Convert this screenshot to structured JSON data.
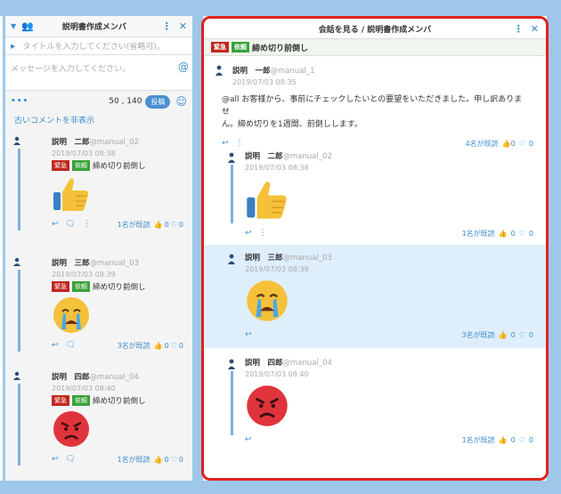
{
  "left_panel": {
    "title": "説明書作成メンバ",
    "title_placeholder": "タイトルを入力してください(省略可)。",
    "message_placeholder": "メッセージを入力してください。",
    "char_count": "50 , 140",
    "post_button": "投稿",
    "hide_old_comments": "古いコメントを非表示",
    "comments": [
      {
        "name": "説明　二郎",
        "uid": "@manual_02",
        "date": "2019/07/03 08:38",
        "tag_urgent": "緊急",
        "tag_request": "依頼",
        "subject": "締め切り前倒し",
        "emoji": "thumbs-up",
        "read_status": "1名が既読",
        "likes": "0",
        "hearts": "0"
      },
      {
        "name": "説明　三郎",
        "uid": "@manual_03",
        "date": "2019/07/03 08:39",
        "tag_urgent": "緊急",
        "tag_request": "依頼",
        "subject": "締め切り前倒し",
        "emoji": "crying-face",
        "read_status": "3名が既読",
        "likes": "0",
        "hearts": "0"
      },
      {
        "name": "説明　四郎",
        "uid": "@manual_04",
        "date": "2019/07/03 08:40",
        "tag_urgent": "緊急",
        "tag_request": "依頼",
        "subject": "締め切り前倒し",
        "emoji": "angry-face",
        "read_status": "1名が既読",
        "likes": "0",
        "hearts": "0"
      }
    ]
  },
  "right_panel": {
    "title": "会話を見る / 説明書作成メンバ",
    "tag_urgent": "緊急",
    "tag_request": "依頼",
    "topic_title": "締め切り前倒し",
    "topic": {
      "name": "説明　一郎",
      "uid": "@manual_1",
      "date": "2019/07/03 08:35",
      "message_line1": "@all お客様から、事前にチェックしたいとの要望をいただきました。申し訳ありませ",
      "message_line2": "ん。締め切りを1週間、前倒しします。",
      "read_status": "4名が既読",
      "likes": "0",
      "hearts": "0"
    },
    "comments": [
      {
        "name": "説明　二郎",
        "uid": "@manual_02",
        "date": "2019/07/03 08:38",
        "emoji": "thumbs-up",
        "read_status": "1名が既読",
        "likes": "0",
        "hearts": "0"
      },
      {
        "name": "説明　三郎",
        "uid": "@manual_03",
        "date": "2019/07/03 08:39",
        "emoji": "crying-face",
        "read_status": "3名が既読",
        "likes": "0",
        "hearts": "0"
      },
      {
        "name": "説明　四郎",
        "uid": "@manual_04",
        "date": "2019/07/03 08:40",
        "emoji": "angry-face",
        "read_status": "1名が既読",
        "likes": "0",
        "hearts": "0"
      }
    ]
  },
  "colors": {
    "accent": "#3b8ed0",
    "urgent": "#c0281f",
    "request": "#3aa23a",
    "highlight_border": "#e0221c",
    "highlight_row": "#deeefa"
  }
}
